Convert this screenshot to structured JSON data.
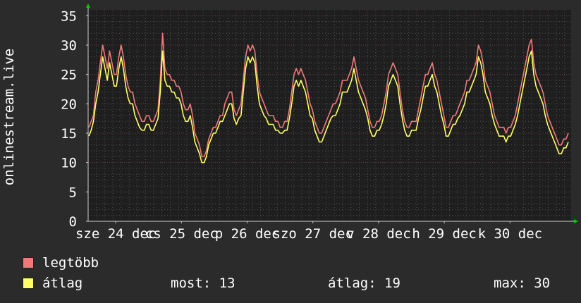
{
  "chart_data": {
    "type": "line",
    "ylabel": "onlinestream.live",
    "ylim": [
      0,
      36
    ],
    "yticks": [
      0,
      5,
      10,
      15,
      20,
      25,
      30,
      35
    ],
    "xtick_labels": [
      "sze 24 dec",
      "cs 25 dec",
      "p 26 dec",
      "szo 27 dec",
      "v 28 dec",
      "h 29 dec",
      "k 30 dec"
    ],
    "grid": true,
    "colors": {
      "background": "#2b2b2b",
      "plot_area": "#1e1e1e",
      "grid": "#505050",
      "axis": "#cccccc",
      "max_line": "#f07a7a",
      "avg_line": "#ffff66",
      "arrow": "#00cc00"
    },
    "series": [
      {
        "name": "legtöbb",
        "color": "#f07a7a",
        "values": [
          16,
          17,
          18,
          22,
          24,
          27,
          30,
          28,
          26,
          29,
          27,
          25,
          25,
          28,
          30,
          28,
          25,
          23,
          22,
          22,
          20,
          19,
          18,
          17,
          17,
          18,
          18,
          17,
          17,
          18,
          19,
          24,
          32,
          26,
          25,
          25,
          24,
          24,
          23,
          23,
          22,
          20,
          19,
          19,
          20,
          18,
          15,
          14,
          13,
          11,
          11,
          12,
          14,
          15,
          16,
          16,
          17,
          18,
          18,
          20,
          21,
          22,
          22,
          19,
          18,
          19,
          20,
          24,
          28,
          30,
          29,
          30,
          29,
          25,
          22,
          21,
          20,
          19,
          18,
          18,
          18,
          17,
          17,
          16,
          16,
          17,
          17,
          19,
          22,
          25,
          26,
          25,
          26,
          25,
          24,
          22,
          20,
          19,
          17,
          16,
          15,
          15,
          16,
          17,
          18,
          19,
          20,
          20,
          21,
          22,
          24,
          24,
          24,
          25,
          26,
          28,
          26,
          24,
          23,
          22,
          21,
          19,
          17,
          16,
          16,
          17,
          17,
          18,
          20,
          22,
          25,
          26,
          27,
          26,
          25,
          22,
          19,
          17,
          16,
          16,
          17,
          17,
          17,
          19,
          21,
          23,
          25,
          25,
          26,
          27,
          25,
          24,
          22,
          20,
          18,
          16,
          16,
          17,
          18,
          18,
          19,
          20,
          21,
          22,
          24,
          24,
          25,
          26,
          27,
          30,
          29,
          27,
          24,
          23,
          22,
          20,
          18,
          17,
          16,
          16,
          16,
          15,
          16,
          16,
          17,
          18,
          20,
          22,
          24,
          26,
          28,
          30,
          31,
          27,
          25,
          24,
          23,
          22,
          20,
          18,
          17,
          16,
          15,
          14,
          13,
          13,
          14,
          14,
          15
        ]
      },
      {
        "name": "átlag",
        "color": "#ffff66",
        "values": [
          14.5,
          15.5,
          17,
          20,
          22,
          25,
          28,
          26,
          24,
          27,
          25,
          23,
          23,
          26,
          28,
          26,
          23,
          21,
          20,
          20,
          18,
          17,
          16,
          15.5,
          15.5,
          16.5,
          16.5,
          15.5,
          15.5,
          16.5,
          17.5,
          22,
          29,
          24,
          23,
          23,
          22,
          22,
          21,
          21,
          20,
          18,
          17,
          17,
          18,
          16,
          13.5,
          12.5,
          11.5,
          10,
          10,
          11,
          13,
          14,
          15,
          15,
          16,
          17,
          17,
          18,
          19,
          20,
          20,
          17.5,
          16.5,
          17.5,
          18,
          22,
          26,
          28,
          27,
          28,
          27,
          23,
          20,
          19,
          18,
          17.5,
          16.5,
          16.5,
          16.5,
          15.5,
          15.5,
          15,
          15,
          15.5,
          15.5,
          17.5,
          20,
          23,
          24,
          23,
          24,
          23,
          22,
          20,
          18,
          17.5,
          15.5,
          14.5,
          13.5,
          13.5,
          14.5,
          15.5,
          16.5,
          17.5,
          18,
          18,
          19,
          20,
          22,
          22,
          22,
          23,
          24,
          26,
          24,
          22,
          21,
          20,
          19,
          17.5,
          15.5,
          14.5,
          14.5,
          15.5,
          15.5,
          16.5,
          18,
          20,
          23,
          24,
          25,
          24,
          23,
          20,
          17.5,
          15.5,
          14.5,
          14.5,
          15.5,
          15.5,
          15.5,
          17.5,
          19,
          21,
          23,
          23,
          24,
          25,
          23,
          22,
          20,
          18,
          16.5,
          14.5,
          14.5,
          15.5,
          16.5,
          16.5,
          17.5,
          18,
          19,
          20,
          22,
          22,
          23,
          24,
          25,
          28,
          27,
          25,
          22,
          21,
          20,
          18,
          16.5,
          15.5,
          14.5,
          14.5,
          14.5,
          13.5,
          14.5,
          14.5,
          15.5,
          16.5,
          18,
          20,
          22,
          24,
          26,
          28,
          29,
          25,
          23,
          22,
          21,
          20,
          18,
          16.5,
          15.5,
          14.5,
          13.5,
          12.5,
          11.5,
          11.5,
          12.5,
          12.5,
          13.5
        ]
      }
    ]
  },
  "legend": [
    {
      "label": "legtöbb",
      "color": "#f07a7a"
    },
    {
      "label": "átlag",
      "color": "#ffff66"
    }
  ],
  "stats": {
    "now": "most: 13",
    "avg": "átlag: 19",
    "max": "max: 30"
  }
}
